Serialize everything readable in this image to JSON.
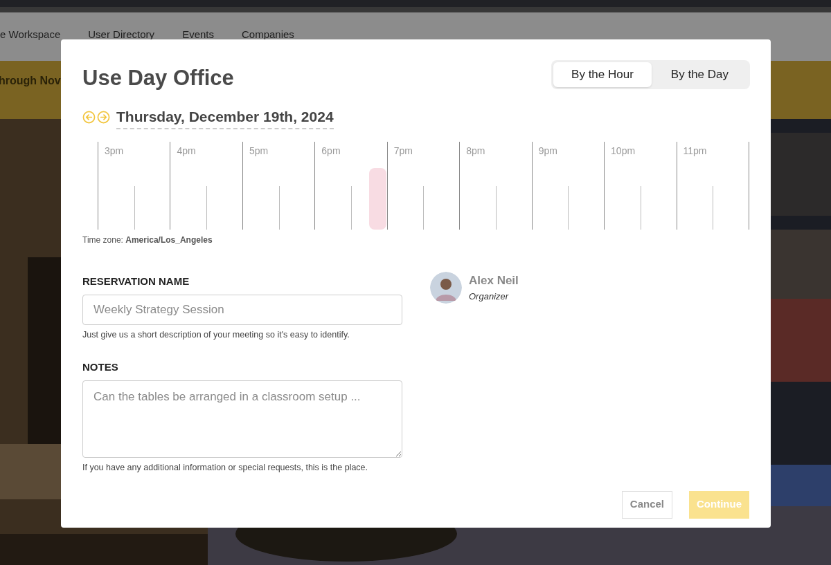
{
  "background": {
    "nav": [
      "e Workspace",
      "User Directory",
      "Events",
      "Companies"
    ],
    "banner": "hrough Nov"
  },
  "modal": {
    "title": "Use Day Office",
    "modes": [
      {
        "label": "By the Hour",
        "selected": true
      },
      {
        "label": "By the Day",
        "selected": false
      }
    ],
    "date": "Thursday, December 19th, 2024",
    "hours": [
      {
        "label": "3pm",
        "quarters": [
          false,
          false,
          false,
          false
        ]
      },
      {
        "label": "4pm",
        "quarters": [
          false,
          false,
          false,
          false
        ]
      },
      {
        "label": "5pm",
        "quarters": [
          false,
          false,
          false,
          false
        ]
      },
      {
        "label": "6pm",
        "quarters": [
          false,
          false,
          false,
          true
        ]
      },
      {
        "label": "7pm",
        "quarters": [
          false,
          false,
          false,
          false
        ]
      },
      {
        "label": "8pm",
        "quarters": [
          false,
          false,
          false,
          false
        ]
      },
      {
        "label": "9pm",
        "quarters": [
          false,
          false,
          false,
          false
        ]
      },
      {
        "label": "10pm",
        "quarters": [
          false,
          false,
          false,
          false
        ]
      },
      {
        "label": "11pm",
        "quarters": [
          false,
          false,
          false,
          false
        ]
      }
    ],
    "timezone": "Time zone: **America/Los_Angeles**",
    "fields": [
      {
        "kind": "input",
        "label": "RESERVATION NAME",
        "placeholder": "Weekly Strategy Session",
        "help": "Just give us a short description of your meeting so it's easy to identify."
      },
      {
        "kind": "textarea",
        "label": "NOTES",
        "placeholder": "Can the tables be arranged in a classroom setup ...",
        "help": "If you have any additional information or special requests, this is the place."
      }
    ],
    "organizer": {
      "name": "Alex Neil",
      "role": "Organizer"
    },
    "buttons": [
      {
        "label": "Cancel",
        "kind": "secondary",
        "disabled": false
      },
      {
        "label": "Continue",
        "kind": "primary",
        "disabled": true
      }
    ]
  }
}
